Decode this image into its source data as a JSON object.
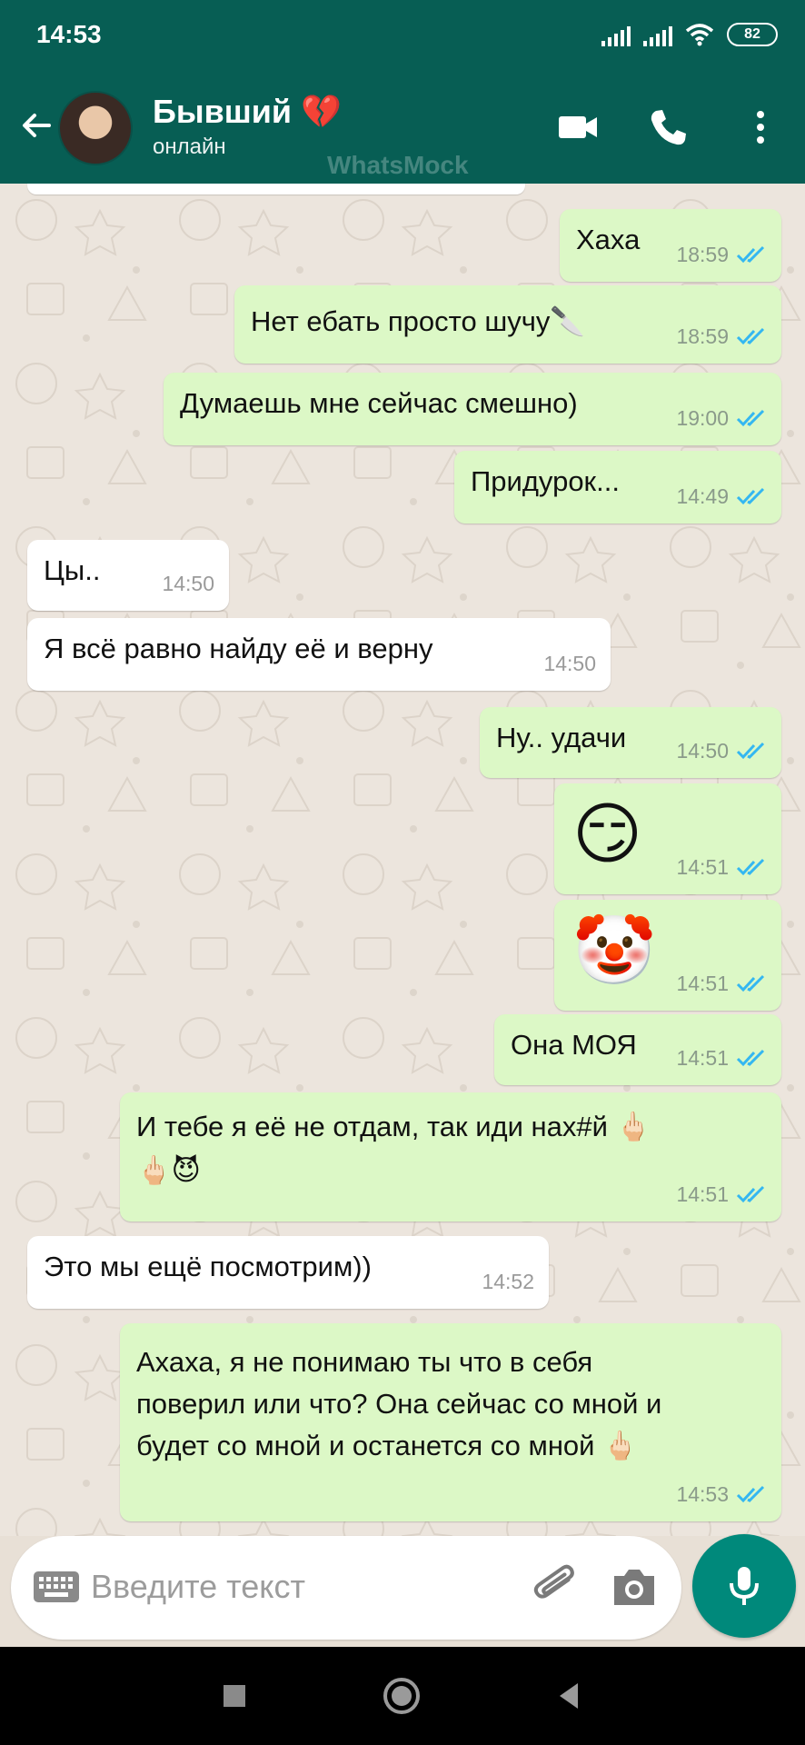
{
  "status_bar": {
    "time": "14:53",
    "battery": "82"
  },
  "header": {
    "contact_name": "Бывший 💔",
    "contact_status": "онлайн",
    "watermark": "WhatsMock"
  },
  "messages": [
    {
      "dir": "out",
      "text": "Хаха",
      "time": "18:59",
      "read": true
    },
    {
      "dir": "out",
      "text": "Нет ебать просто шучу🔪",
      "time": "18:59",
      "read": true
    },
    {
      "dir": "out",
      "text": "Думаешь мне сейчас смешно)",
      "time": "19:00",
      "read": true
    },
    {
      "dir": "out",
      "text": "Придурок...",
      "time": "14:49",
      "read": true
    },
    {
      "dir": "in",
      "text": "Цы..",
      "time": "14:50"
    },
    {
      "dir": "in",
      "text": "Я всё равно найду её и верну",
      "time": "14:50"
    },
    {
      "dir": "out",
      "text": "Ну.. удачи",
      "time": "14:50",
      "read": true
    },
    {
      "dir": "out",
      "text": "😏",
      "time": "14:51",
      "read": true
    },
    {
      "dir": "out",
      "text": "🤡",
      "time": "14:51",
      "read": true
    },
    {
      "dir": "out",
      "text": "Она МОЯ",
      "time": "14:51",
      "read": true
    },
    {
      "dir": "out",
      "text": "И тебе я её не отдам, так иди нах#й 🖕🏻\n🖕🏻😈",
      "time": "14:51",
      "read": true
    },
    {
      "dir": "in",
      "text": "Это мы ещё посмотрим))",
      "time": "14:52"
    },
    {
      "dir": "out",
      "text": "Ахаха, я не понимаю ты что в себя\nповерил или что? Она сейчас со мной и\nбудет со мной и останется со мной 🖕🏻",
      "time": "14:53",
      "read": true
    }
  ],
  "input": {
    "placeholder": "Введите текст",
    "value": ""
  },
  "colors": {
    "header": "#075e54",
    "outgoing": "#dcf8c6",
    "incoming": "#ffffff",
    "read_tick": "#34b7f1",
    "fab": "#00897b"
  },
  "icons": [
    "back-arrow-icon",
    "video-call-icon",
    "phone-icon",
    "more-vert-icon",
    "keyboard-icon",
    "attach-icon",
    "camera-icon",
    "mic-icon"
  ]
}
